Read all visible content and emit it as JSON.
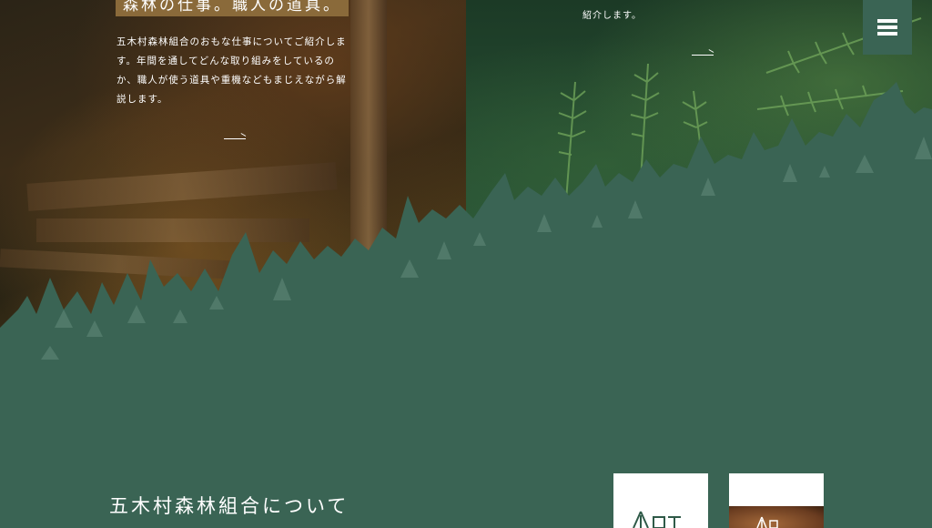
{
  "hero": {
    "title": "森林の仕事。職人の道具。",
    "description": "五木村森林組合のおもな仕事についてご紹介します。年間を通してどんな取り組みをしているのか、職人が使う道具や重機などもまじえながら解説します。",
    "right_text": "紹介します。"
  },
  "menu": {
    "icon": "hamburger-icon"
  },
  "about": {
    "title": "五木村森林組合について"
  },
  "colors": {
    "forest_green": "#3a6454",
    "title_bg": "#8a6a3a"
  }
}
